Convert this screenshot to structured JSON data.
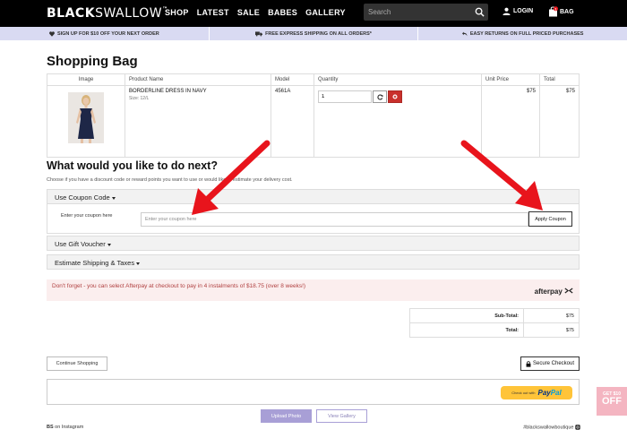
{
  "header": {
    "logo_bold": "BLACK",
    "logo_light": "SWALLOW",
    "logo_tm": "™",
    "nav": [
      "SHOP",
      "LATEST",
      "SALE",
      "BABES",
      "GALLERY"
    ],
    "search_placeholder": "Search",
    "login_label": "LOGIN",
    "bag_label": "BAG",
    "bag_count": "1"
  },
  "promo": {
    "items": [
      "SIGN UP FOR $10 OFF YOUR NEXT ORDER",
      "FREE EXPRESS SHIPPING ON ALL ORDERS*",
      "EASY RETURNS ON FULL PRICED PURCHASES"
    ]
  },
  "page_title": "Shopping Bag",
  "cart": {
    "headers": {
      "image": "Image",
      "product": "Product Name",
      "model": "Model",
      "quantity": "Quantity",
      "unit_price": "Unit Price",
      "total": "Total"
    },
    "items": [
      {
        "name": "BORDERLINE DRESS IN NAVY",
        "size": "Size: 12/L",
        "model": "4561A",
        "quantity": "1",
        "unit_price": "$75",
        "total": "$75"
      }
    ]
  },
  "next": {
    "title": "What would you like to do next?",
    "hint": "Choose if you have a discount code or reward points you want to use or would like to estimate your delivery cost.",
    "coupon_heading": "Use Coupon Code",
    "coupon_label": "Enter your coupon here",
    "coupon_placeholder": "Enter your coupon here",
    "apply_label": "Apply Coupon",
    "voucher_heading": "Use Gift Voucher",
    "shipping_heading": "Estimate Shipping & Taxes"
  },
  "afterpay": {
    "message": "Don't forget - you can select Afterpay at checkout to pay in 4 instalments of $18.75 (over 8 weeks!)",
    "logo_text": "afterpay"
  },
  "totals": [
    {
      "label": "Sub-Total:",
      "value": "$75"
    },
    {
      "label": "Total:",
      "value": "$75"
    }
  ],
  "actions": {
    "continue_label": "Continue Shopping",
    "checkout_label": "Secure Checkout",
    "paypal_small": "Check out with",
    "paypal_pay": "Pay",
    "paypal_pal": "Pal"
  },
  "instagram": {
    "upload_label": "Upload Photo",
    "gallery_label": "View Gallery",
    "bs_prefix": "BS",
    "bs_suffix": " on Instagram",
    "hashtag": "#blackswallowboutique"
  },
  "get_off": {
    "small": "GET $10",
    "big": "OFF"
  },
  "colors": {
    "promo_bar": "#d9daf2",
    "remove_button": "#c9302c",
    "afterpay_bg": "#fbeeee",
    "paypal_yellow": "#ffc439",
    "upload_purple": "#a89fd6",
    "get_off_pink": "#f4b5c1",
    "arrow_red": "#e8141c"
  }
}
